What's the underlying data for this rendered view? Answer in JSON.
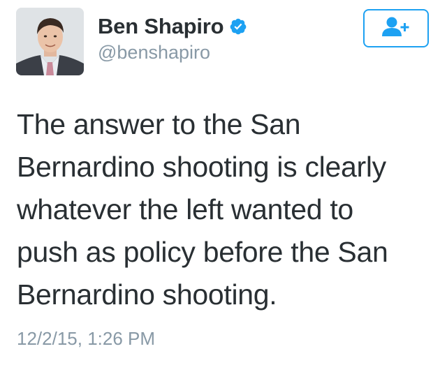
{
  "tweet": {
    "author": {
      "display_name": "Ben Shapiro",
      "handle": "@benshapiro",
      "verified_icon": "verified-badge-icon",
      "avatar": "profile-photo"
    },
    "follow_button": {
      "icon": "add-user-icon"
    },
    "text_lines": [
      "The answer to the San",
      "Bernardino shooting is clearly",
      "whatever the left wanted to",
      "push as policy before the San",
      "Bernardino shooting."
    ],
    "timestamp": "12/2/15, 1:26 PM"
  },
  "colors": {
    "accent": "#1da1f2",
    "text": "#292f33",
    "muted": "#8899a6"
  }
}
